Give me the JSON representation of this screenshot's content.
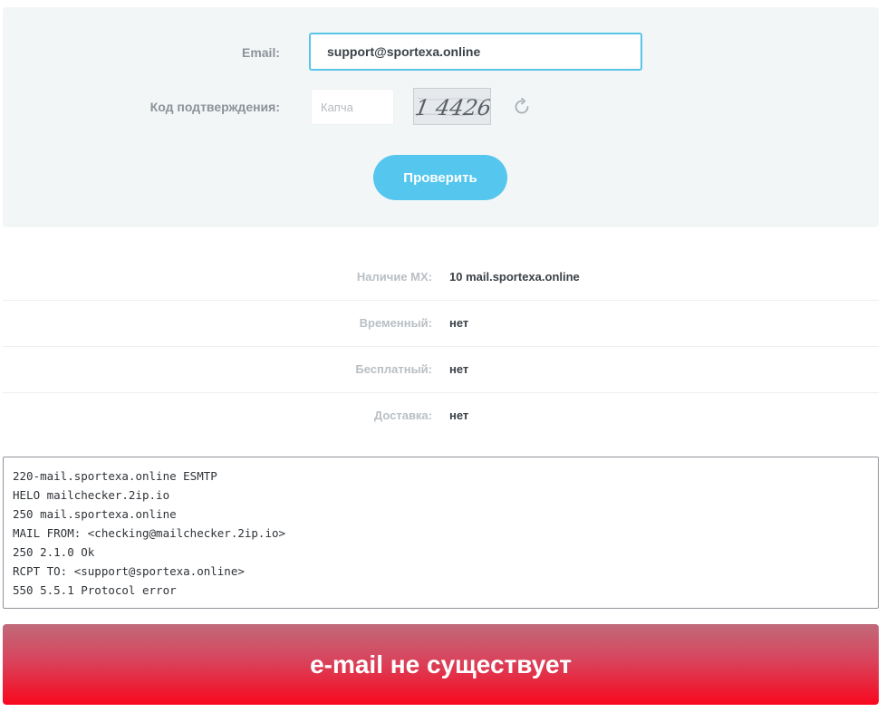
{
  "form": {
    "email_label": "Email:",
    "email_value": "support@sportexa.online",
    "code_label": "Код подтверждения:",
    "captcha_placeholder": "Капча",
    "captcha_text": "1 4426",
    "refresh_icon": "refresh-icon",
    "check_button_label": "Проверить",
    "accent_color": "#55c6ee"
  },
  "results": [
    {
      "label": "Наличие MX:",
      "value": "10 mail.sportexa.online"
    },
    {
      "label": "Временный:",
      "value": "нет"
    },
    {
      "label": "Бесплатный:",
      "value": "нет"
    },
    {
      "label": "Доставка:",
      "value": "нет"
    }
  ],
  "smtp_log": [
    "220-mail.sportexa.online ESMTP",
    "HELO mailchecker.2ip.io",
    "250 mail.sportexa.online",
    "MAIL FROM: <checking@mailchecker.2ip.io>",
    "250 2.1.0 Ok",
    "RCPT TO: <support@sportexa.online>",
    "550 5.5.1 Protocol error"
  ],
  "banner": {
    "text": "e-mail не существует",
    "color": "#f8081e"
  }
}
